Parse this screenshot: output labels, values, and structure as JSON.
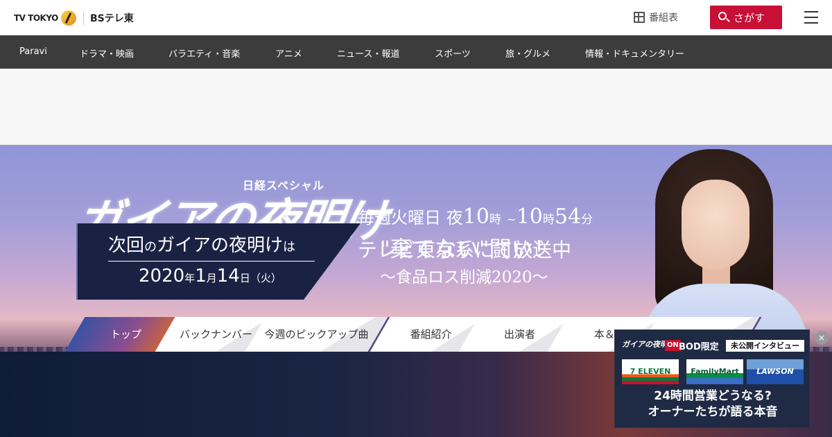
{
  "header": {
    "logo_tvtokyo": "TV TOKYO",
    "logo_bs": "BSテレ東",
    "schedule_label": "番組表",
    "search_label": "さがす"
  },
  "nav": {
    "items": [
      "Paravi",
      "ドラマ・映画",
      "バラエティ・音楽",
      "アニメ",
      "ニュース・報道",
      "スポーツ",
      "旅・グルメ",
      "情報・ドキュメンタリー"
    ]
  },
  "hero": {
    "kicker": "日経スペシャル",
    "title": "ガイアの夜明け",
    "schedule_prefix": "毎週火曜日 夜",
    "start_hour": "10",
    "hour_unit": "時",
    "tilde": "~",
    "end_hour": "10",
    "end_min": "54",
    "min_unit": "分",
    "broadcast": "テレビ東京系にて放送中"
  },
  "tabs": {
    "items": [
      "トップ",
      "バックナンバー",
      "今週のピックアップ曲",
      "番組紹介",
      "出演者",
      "本＆D",
      ""
    ],
    "active_index": 0
  },
  "next": {
    "label_main1": "次回",
    "label_small1": "の",
    "label_main2": "ガイアの夜明け",
    "label_small2": "は",
    "year": "2020",
    "year_unit": "年",
    "month": "1",
    "month_unit": "月",
    "day": "14",
    "day_unit": "日",
    "weekday": "（火）",
    "episode_title": "\"棄てない\"闘い！",
    "episode_sub": "～食品ロス削減2020～"
  },
  "popup": {
    "logo": "ガイアの夜明け",
    "on_badge": "ON",
    "bod_label": "BOD限定",
    "tag": "未公開インタビュー",
    "store1": "7 ELEVEN",
    "store2": "FamilyMart",
    "store3": "LAWSON",
    "line1": "24時間営業どうなる?",
    "line2": "オーナーたちが語る本音",
    "close": "×"
  },
  "colors": {
    "accent": "#c80f36",
    "nav_bg": "#3c3c3c"
  }
}
